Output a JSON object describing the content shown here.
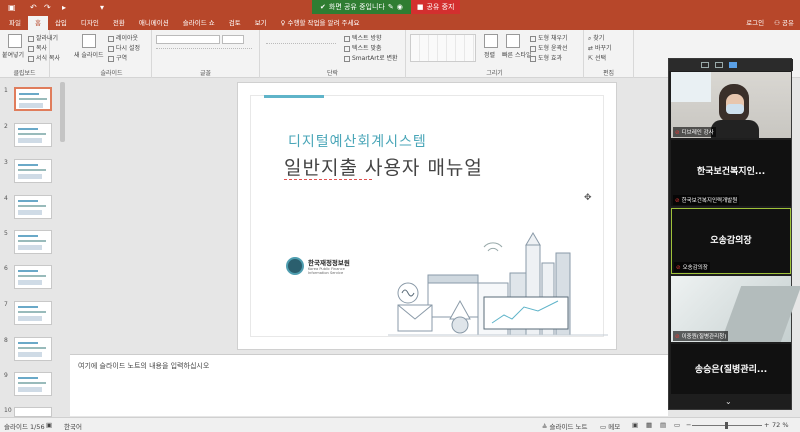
{
  "window": {
    "quick_access": [
      "↶",
      "↷",
      "▸",
      "▾"
    ]
  },
  "share_bar": {
    "sharing_label": "화면 공유 중입니다",
    "stop_label": "공유 중지"
  },
  "tabs": [
    "파일",
    "홈",
    "삽입",
    "디자인",
    "전환",
    "애니메이션",
    "슬라이드 쇼",
    "검토",
    "보기"
  ],
  "active_tab": "홈",
  "search_hint": "수행할 작업을 알려 주세요",
  "account": {
    "login": "로그인",
    "share": "공유"
  },
  "ribbon": {
    "clipboard": {
      "label": "클립보드",
      "paste": "붙여넣기",
      "cut": "잘라내기",
      "copy": "복사",
      "format_painter": "서식 복사"
    },
    "slides": {
      "label": "슬라이드",
      "new_slide": "새 슬라이드",
      "layout": "레이아웃",
      "reset": "다시 설정",
      "section": "구역"
    },
    "font": {
      "label": "글꼴"
    },
    "paragraph": {
      "label": "단락",
      "text_direction": "텍스트 방향",
      "align_text": "텍스트 맞춤",
      "smartart": "SmartArt로 변환"
    },
    "drawing": {
      "label": "그리기",
      "arrange": "정렬",
      "quick_styles": "빠른 스타일",
      "fill": "도형 채우기",
      "outline": "도형 윤곽선",
      "effects": "도형 효과"
    },
    "editing": {
      "label": "편집",
      "find": "찾기",
      "replace": "바꾸기",
      "select": "선택"
    }
  },
  "thumbnails": [
    1,
    2,
    3,
    4,
    5,
    6,
    7,
    8,
    9,
    10
  ],
  "selected_slide": 1,
  "slide": {
    "title_line1": "디지털예산회계시스템",
    "title_line2": "일반지출 사용자 매뉴얼",
    "logo_name": "한국재정정보원",
    "logo_sub_en1": "Korea Public Finance",
    "logo_sub_en2": "Information Service"
  },
  "notes_placeholder": "여기에 슬라이드 노트의 내용을 입력하십시오",
  "status": {
    "slide_count": "슬라이드 1/56",
    "language": "한국어",
    "notes_btn": "슬라이드 노트",
    "comments_btn": "메모",
    "zoom": "72 %"
  },
  "zoom_panel": {
    "tiles": [
      {
        "name": "",
        "label": "디브레인 강사"
      },
      {
        "name": "한국보건복지인...",
        "label": "한국보건복지인력개발원"
      },
      {
        "name": "오송감의장",
        "label": "오송감의장"
      },
      {
        "name": "",
        "label": "이중원(질병관리청)"
      },
      {
        "name": "송승은(질병관리...",
        "label": ""
      }
    ]
  },
  "colors": {
    "accent": "#b7472a",
    "slide_title": "#4aa6b8",
    "share_green": "#2f7d32",
    "share_red": "#d32f2f",
    "tile_highlight": "#9fc23a"
  }
}
